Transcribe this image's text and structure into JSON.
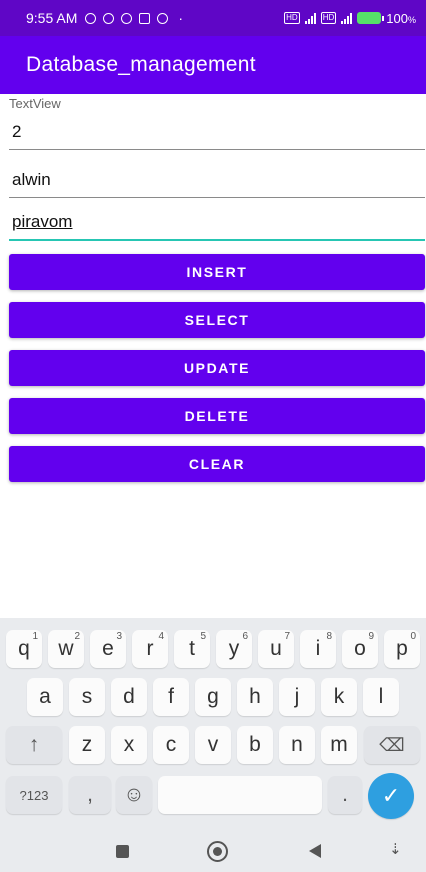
{
  "status_bar": {
    "time": "9:55 AM",
    "battery": "100",
    "battery_suffix": "%"
  },
  "app_bar": {
    "title": "Database_management"
  },
  "form": {
    "label": "TextView",
    "fields": [
      {
        "value": "2"
      },
      {
        "value": "alwin"
      },
      {
        "value": "piravom"
      }
    ]
  },
  "buttons": {
    "insert": "INSERT",
    "select": "SELECT",
    "update": "UPDATE",
    "delete": "DELETE",
    "clear": "CLEAR"
  },
  "keyboard": {
    "row1": [
      {
        "key": "q",
        "hint": "1"
      },
      {
        "key": "w",
        "hint": "2"
      },
      {
        "key": "e",
        "hint": "3"
      },
      {
        "key": "r",
        "hint": "4"
      },
      {
        "key": "t",
        "hint": "5"
      },
      {
        "key": "y",
        "hint": "6"
      },
      {
        "key": "u",
        "hint": "7"
      },
      {
        "key": "i",
        "hint": "8"
      },
      {
        "key": "o",
        "hint": "9"
      },
      {
        "key": "p",
        "hint": "0"
      }
    ],
    "row2": [
      "a",
      "s",
      "d",
      "f",
      "g",
      "h",
      "j",
      "k",
      "l"
    ],
    "row3": [
      "z",
      "x",
      "c",
      "v",
      "b",
      "n",
      "m"
    ],
    "shift_icon": "↑",
    "backspace_icon": "⌫",
    "symbols": "?123",
    "comma": ",",
    "emoji_icon": "☺",
    "period": ".",
    "enter_icon": "✓"
  },
  "nav_bar": {
    "keyboard_toggle_icon": "⇣"
  },
  "colors": {
    "primary": "#6200ee",
    "status_bar": "#5f06c6",
    "focus_underline": "#26c6b3",
    "enter_key": "#2e9fe0"
  }
}
